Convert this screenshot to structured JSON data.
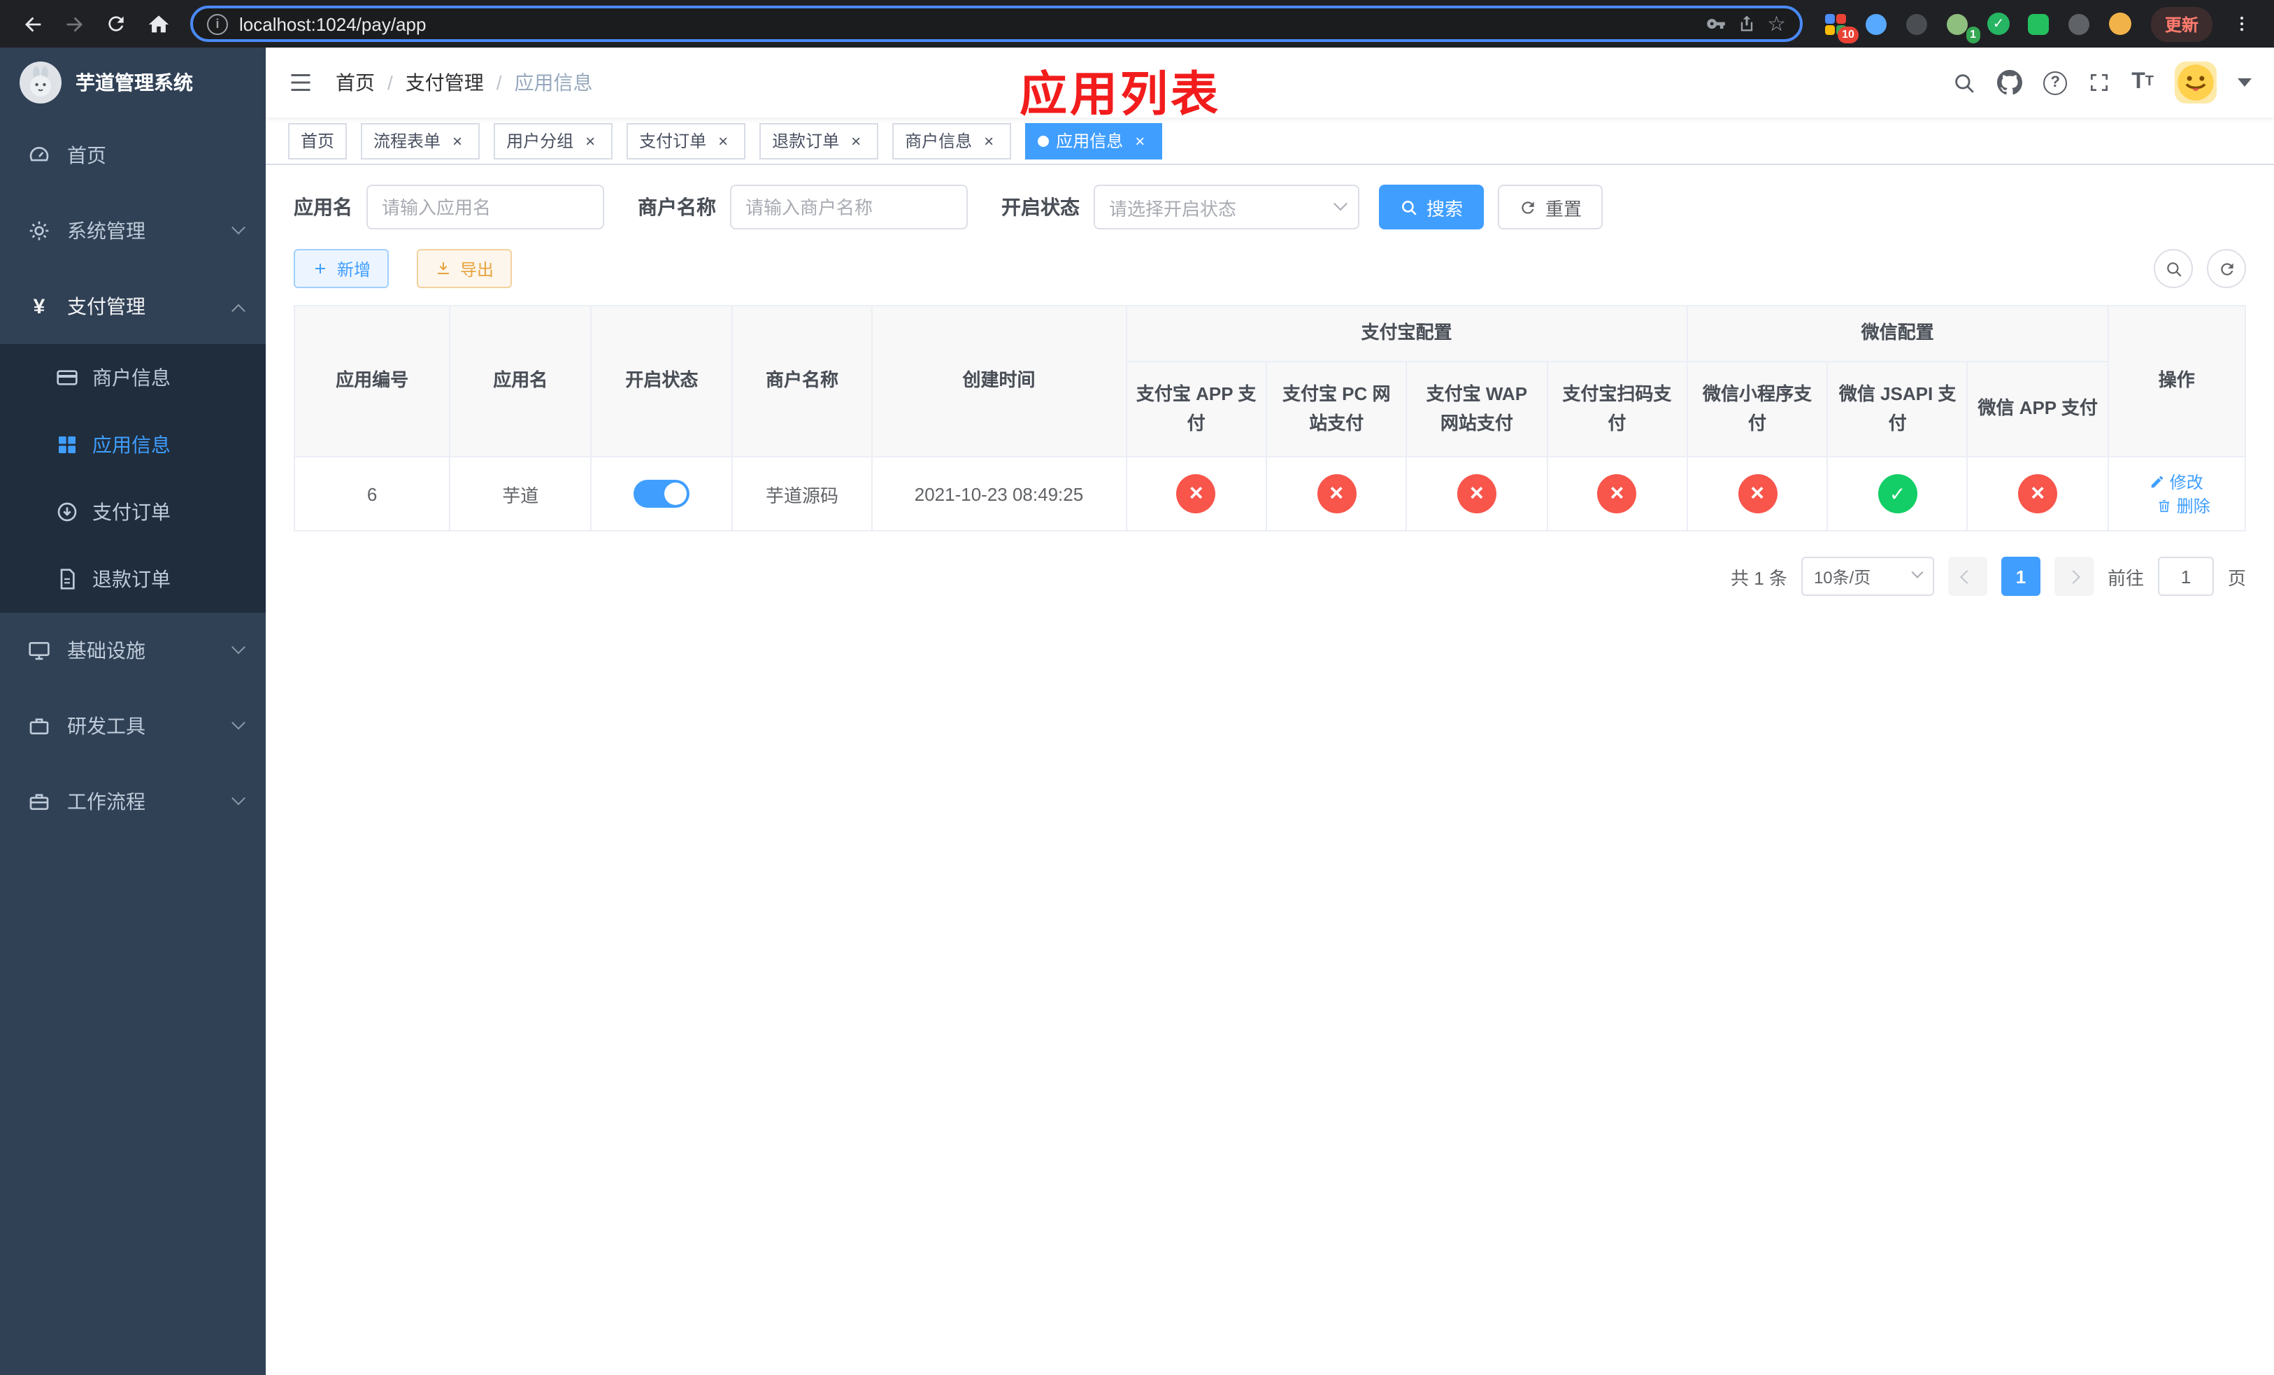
{
  "browser": {
    "url": "localhost:1024/pay/app",
    "update_label": "更新",
    "ext_badge_1": "10",
    "ext_badge_2": "1"
  },
  "sidebar": {
    "title": "芋道管理系统",
    "items": [
      {
        "label": "首页"
      },
      {
        "label": "系统管理"
      },
      {
        "label": "支付管理"
      },
      {
        "label": "基础设施"
      },
      {
        "label": "研发工具"
      },
      {
        "label": "工作流程"
      }
    ],
    "submenu": [
      {
        "label": "商户信息",
        "active": false
      },
      {
        "label": "应用信息",
        "active": true
      },
      {
        "label": "支付订单",
        "active": false
      },
      {
        "label": "退款订单",
        "active": false
      }
    ]
  },
  "navbar": {
    "breadcrumb": [
      "首页",
      "支付管理",
      "应用信息"
    ]
  },
  "annotation": "应用列表",
  "tabs": [
    {
      "label": "首页",
      "active": false
    },
    {
      "label": "流程表单",
      "active": false
    },
    {
      "label": "用户分组",
      "active": false
    },
    {
      "label": "支付订单",
      "active": false
    },
    {
      "label": "退款订单",
      "active": false
    },
    {
      "label": "商户信息",
      "active": false
    },
    {
      "label": "应用信息",
      "active": true
    }
  ],
  "filters": {
    "app_name": {
      "label": "应用名",
      "placeholder": "请输入应用名"
    },
    "merchant_name": {
      "label": "商户名称",
      "placeholder": "请输入商户名称"
    },
    "status": {
      "label": "开启状态",
      "placeholder": "请选择开启状态"
    },
    "search": "搜索",
    "reset": "重置"
  },
  "toolbar": {
    "add": "新增",
    "export": "导出"
  },
  "table": {
    "groups": {
      "alipay": "支付宝配置",
      "wechat": "微信配置"
    },
    "columns": {
      "id": "应用编号",
      "name": "应用名",
      "status": "开启状态",
      "merchant": "商户名称",
      "created": "创建时间",
      "alipay_app": "支付宝 APP 支付",
      "alipay_pc": "支付宝 PC 网站支付",
      "alipay_wap": "支付宝 WAP 网站支付",
      "alipay_qr": "支付宝扫码支付",
      "wx_mini": "微信小程序支付",
      "wx_jsapi": "微信 JSAPI 支付",
      "wx_app": "微信 APP 支付",
      "actions": "操作"
    },
    "rows": [
      {
        "id": "6",
        "name": "芋道",
        "status_on": true,
        "merchant": "芋道源码",
        "created": "2021-10-23 08:49:25",
        "alipay_app": false,
        "alipay_pc": false,
        "alipay_wap": false,
        "alipay_qr": false,
        "wx_mini": false,
        "wx_jsapi": true,
        "wx_app": false,
        "edit": "修改",
        "delete": "删除"
      }
    ]
  },
  "pagination": {
    "total": "共 1 条",
    "page_size": "10条/页",
    "page": "1",
    "goto": "前往",
    "goto_value": "1",
    "unit": "页"
  },
  "colors": {
    "primary": "#409eff",
    "success": "#13ce66",
    "danger": "#f8554b",
    "sidebar_bg": "#304156",
    "submenu_bg": "#1f2d3d",
    "annotation": "#f21c1c"
  }
}
